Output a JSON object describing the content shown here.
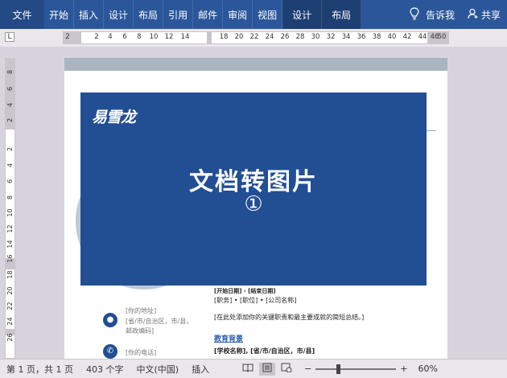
{
  "ribbon": {
    "file_tab": "文件",
    "tabs": [
      "开始",
      "插入",
      "设计",
      "布局",
      "引用",
      "邮件",
      "审阅",
      "视图"
    ],
    "context_tabs": [
      "设计",
      "布局"
    ],
    "tell_me": "告诉我",
    "share": "共享"
  },
  "ruler": {
    "corner": "L",
    "ticks": [
      "2",
      "2",
      "4",
      "6",
      "8",
      "10",
      "12",
      "14",
      "18",
      "20",
      "22",
      "24",
      "26",
      "28",
      "30",
      "32",
      "34",
      "36",
      "38",
      "40",
      "42",
      "44",
      "46",
      "50"
    ],
    "vticks": [
      "8",
      "6",
      "4",
      "2",
      "2",
      "4",
      "6",
      "8",
      "10",
      "12",
      "14",
      "16",
      "18",
      "20",
      "22",
      "24",
      "26"
    ]
  },
  "overlay": {
    "logo": "易雪龙",
    "title": "文档转图片",
    "number": "①"
  },
  "resume": {
    "dates": "[开始日期] - [结束日期]",
    "job": "[职务] • [职位] • [公司名称]",
    "summary": "[在此处添加你的关键职责和最主要成就的简短总结。]",
    "education_heading": "教育背景",
    "school": "[学校名称], [省/市/自治区，市/县]",
    "address_label": "[你的地址]",
    "address_detail_1": "[省/市/自治区，市/县，",
    "address_detail_2": "邮政编码]",
    "phone_label": "[你的电话]"
  },
  "status": {
    "page": "第 1 页，共 1 页",
    "words": "403 个字",
    "language": "中文(中国)",
    "mode": "插入",
    "zoom_minus": "−",
    "zoom_plus": "+",
    "zoom": "60%",
    "zoom_level": 0.6
  },
  "colors": {
    "ribbon": "#2b579a",
    "overlay": "#224e94"
  }
}
